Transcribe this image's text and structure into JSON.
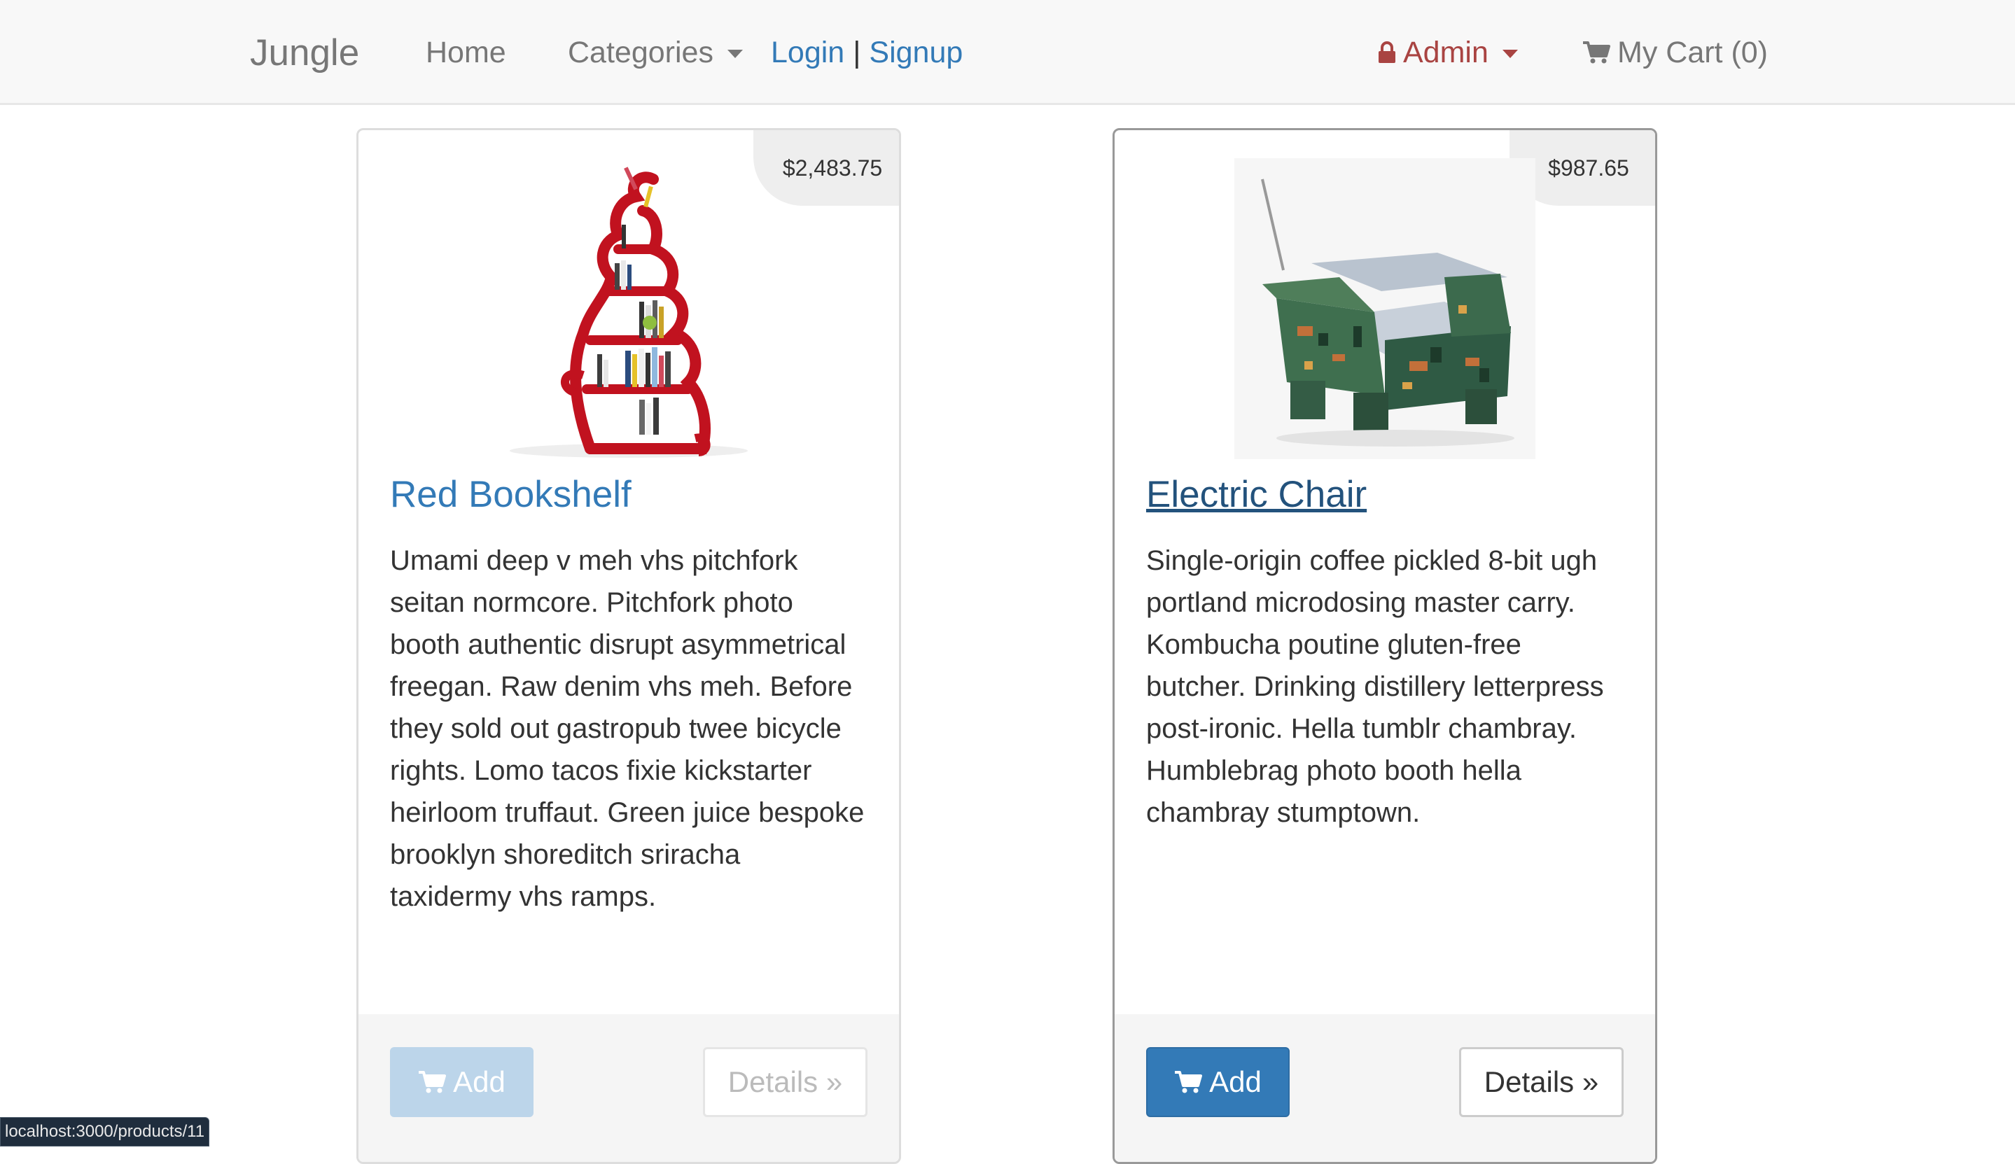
{
  "navbar": {
    "brand": "Jungle",
    "home": "Home",
    "categories": "Categories",
    "login": "Login",
    "separator": "|",
    "signup": "Signup",
    "admin": "Admin",
    "cart": "My Cart (0)"
  },
  "products": [
    {
      "price": "$2,483.75",
      "title": "Red Bookshelf",
      "description": "Umami deep v meh vhs pitchfork seitan normcore. Pitchfork photo booth authentic disrupt asymmetrical freegan. Raw denim vhs meh. Before they sold out gastropub twee bicycle rights. Lomo tacos fixie kickstarter heirloom truffaut. Green juice bespoke brooklyn shoreditch sriracha taxidermy vhs ramps.",
      "add_label": "Add",
      "details_label": "Details »"
    },
    {
      "price": "$987.65",
      "title": "Electric Chair",
      "description": "Single-origin coffee pickled 8-bit ugh portland microdosing master carry. Kombucha poutine gluten-free butcher. Drinking distillery letterpress post-ironic. Hella tumblr chambray. Humblebrag photo booth hella chambray stumptown.",
      "add_label": "Add",
      "details_label": "Details »"
    }
  ],
  "status_bar": {
    "url": "localhost:3000/products/11"
  },
  "colors": {
    "link": "#337ab7",
    "admin": "#a94442",
    "primary_button": "#337ab7",
    "navbar_bg": "#f8f8f8"
  },
  "icons": {
    "admin": "lock-icon",
    "cart": "cart-icon",
    "add": "cart-icon"
  }
}
